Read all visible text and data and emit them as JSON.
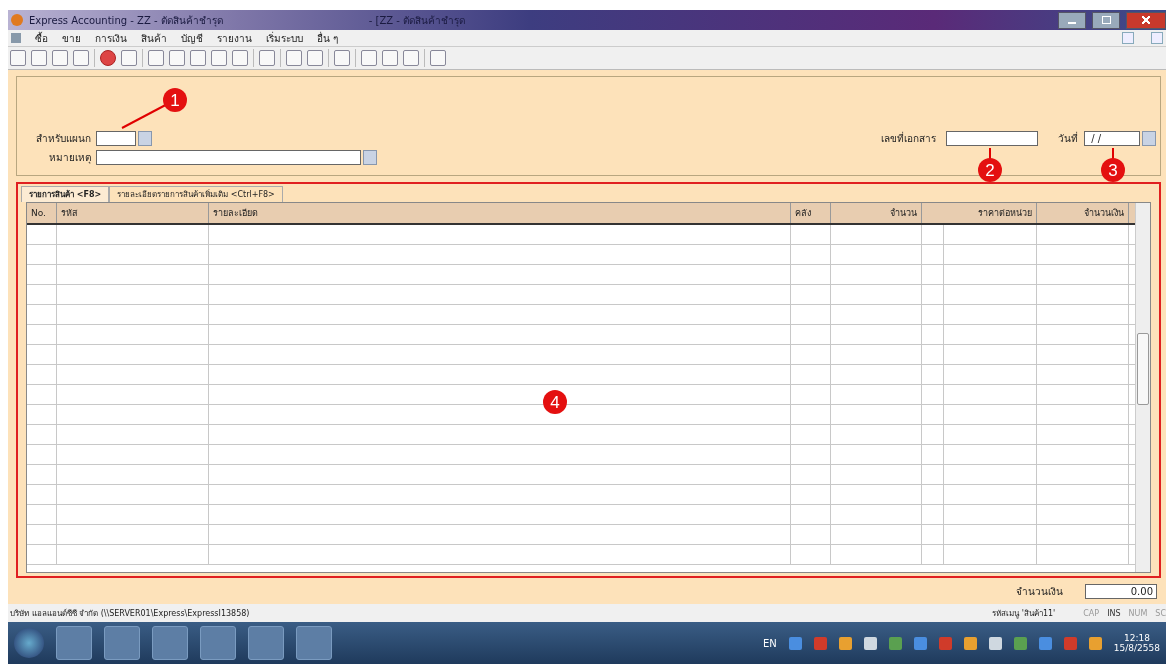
{
  "window": {
    "title": "Express Accounting - ZZ - ตัดสินค้าชำรุด",
    "document_title": "- [ZZ - ตัดสินค้าชำรุด"
  },
  "menu": [
    "ซื้อ",
    "ขาย",
    "การเงิน",
    "สินค้า",
    "บัญชี",
    "รายงาน",
    "เริ่มระบบ",
    "อื่น ๆ"
  ],
  "form": {
    "department": {
      "label": "สำหรับแผนก"
    },
    "note": {
      "label": "หมายเหตุ"
    },
    "doc_no": {
      "label": "เลขที่เอกสาร"
    },
    "date": {
      "label": "วันที่",
      "value": " / /"
    }
  },
  "tabs": [
    {
      "label": "รายการสินค้า <F8>",
      "selected": true
    },
    {
      "label": "รายละเอียดรายการสินค้าเพิ่มเติม <Ctrl+F8>",
      "selected": false
    }
  ],
  "table": {
    "columns": [
      "No.",
      "รหัส",
      "รายละเอียด",
      "คลัง",
      "จำนวน",
      null,
      "ราคาต่อหน่วย",
      "จำนวนเงิน"
    ]
  },
  "total": {
    "label": "จำนวนเงิน",
    "value": "0.00"
  },
  "status_bar": {
    "company": "บริษัท แอลแอนด์ซีซี จำกัด (\\\\SERVER01\\Express\\ExpressI13858)",
    "menu_code": "รหัสเมนู  'สินค้า11'",
    "indicators": [
      "CAP",
      "INS",
      "NUM",
      "SC"
    ]
  },
  "taskbar": {
    "language": "EN",
    "time": "12:18",
    "date": "15/8/2558"
  },
  "annotations": [
    {
      "label": "1"
    },
    {
      "label": "2"
    },
    {
      "label": "3"
    },
    {
      "label": "4"
    }
  ]
}
